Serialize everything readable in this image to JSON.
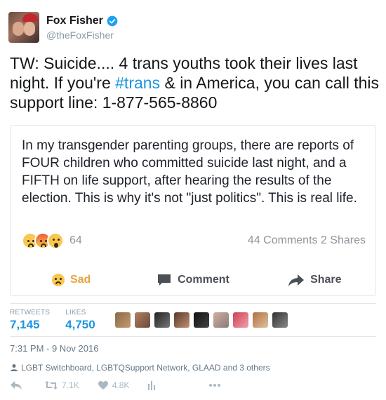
{
  "user": {
    "display_name": "Fox Fisher",
    "handle": "@theFoxFisher"
  },
  "tweet": {
    "text_before": "TW: Suicide.... 4 trans youths took their lives last night. If you're ",
    "hashtag": "#trans",
    "text_after": " & in America, you can call this support line: 1-877-565-8860"
  },
  "embedded_post": {
    "text": "In my transgender parenting groups, there are reports of FOUR children who committed suicide last night, and a FIFTH on life support, after hearing the results of the election.  This is why it's not \"just politics\".  This is real life.",
    "reaction_count": "64",
    "stats": "44 Comments 2 Shares",
    "actions": {
      "sad": "Sad",
      "comment": "Comment",
      "share": "Share"
    }
  },
  "stats": {
    "retweets_label": "RETWEETS",
    "retweets": "7,145",
    "likes_label": "LIKES",
    "likes": "4,750"
  },
  "timestamp": "7:31 PM - 9 Nov 2016",
  "liked_by": "LGBT Switchboard, LGBTQSupport Network, GLAAD and 3 others",
  "actions": {
    "retweet_count": "7.1K",
    "like_count": "4.8K"
  },
  "colors": {
    "link": "#1b95e0",
    "sad_reaction": "#e9a23b",
    "muted": "#8899a6"
  }
}
